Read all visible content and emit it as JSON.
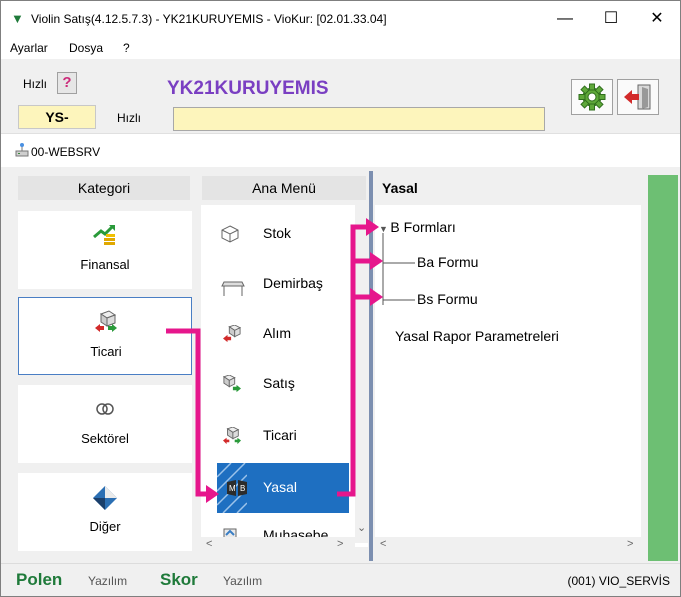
{
  "window": {
    "title": "Violin Satış(4.12.5.7.3)  - YK21KURUYEMIS - VioKur: [02.01.33.04]",
    "minimize": "—",
    "maximize": "☐",
    "close": "✕"
  },
  "menubar": [
    "Ayarlar",
    "Dosya",
    "?"
  ],
  "header": {
    "hizli_label": "Hızlı",
    "help": "?",
    "company": "YK21KURUYEMIS",
    "ys_tab": "YS-",
    "hizli_input_label": "Hızlı",
    "hizli_input_value": ""
  },
  "server": "00-WEBSRV",
  "categories": {
    "header": "Kategori",
    "items": [
      {
        "label": "Finansal",
        "icon": "finance-icon"
      },
      {
        "label": "Ticari",
        "icon": "trade-icon",
        "selected": true
      },
      {
        "label": "Sektörel",
        "icon": "rings-icon"
      },
      {
        "label": "Diğer",
        "icon": "diamond-icon"
      }
    ]
  },
  "main_menu": {
    "header": "Ana Menü",
    "items": [
      {
        "label": "Stok",
        "icon": "cube-icon"
      },
      {
        "label": "Demirbaş",
        "icon": "table-icon"
      },
      {
        "label": "Alım",
        "icon": "purchase-icon"
      },
      {
        "label": "Satış",
        "icon": "sales-icon"
      },
      {
        "label": "Ticari",
        "icon": "trade-icon"
      },
      {
        "label": "Yasal",
        "icon": "legal-icon",
        "selected": true
      },
      {
        "label": "Muhasebe",
        "icon": "accounting-icon"
      }
    ]
  },
  "tree": {
    "header": "Yasal",
    "items": [
      "B Formları",
      "Ba Formu",
      "Bs Formu",
      "Yasal Rapor Parametreleri"
    ]
  },
  "status": {
    "brand1": "Polen",
    "brand1_sub": "Yazılım",
    "brand2": "Skor",
    "brand2_sub": "Yazılım",
    "right": "(001) VIO_SERVİS"
  },
  "colors": {
    "accent_purple": "#7a3fc2",
    "highlight_yellow": "#fdf5bc",
    "selection_blue": "#1e6fc1",
    "arrow_magenta": "#e6168c",
    "brand_green": "#1f7a3a",
    "side_green": "#6dbf73"
  }
}
